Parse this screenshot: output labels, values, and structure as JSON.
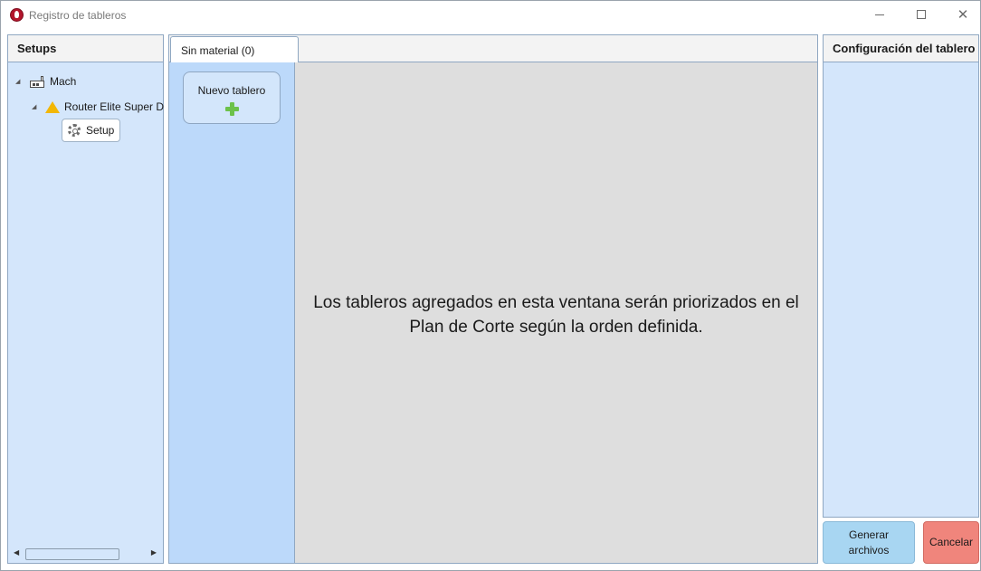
{
  "window": {
    "title": "Registro de tableros"
  },
  "setups_panel": {
    "header": "Setups",
    "tree": {
      "machine": "Mach",
      "router": "Router Elite Super D",
      "setup": "Setup"
    }
  },
  "center": {
    "tab_label": "Sin material (0)",
    "new_board_label": "Nuevo tablero",
    "message": "Los tableros agregados en esta ventana serán priorizados en el Plan de Corte según la orden definida."
  },
  "config_panel": {
    "header": "Configuración del tablero"
  },
  "buttons": {
    "generate": "Generar archivos",
    "cancel": "Cancelar"
  },
  "icons": {
    "app": "app-logo-icon",
    "machine": "factory-icon",
    "router": "warning-icon",
    "setup": "gear-icon",
    "new_board": "plus-icon"
  },
  "colors": {
    "panel_bg": "#d4e6fb",
    "boards_column_bg": "#bcd9fa",
    "generate_button": "#a8d6f2",
    "cancel_button": "#f0857c",
    "plus_icon": "#6cc24a",
    "warning_icon": "#f2b705"
  }
}
